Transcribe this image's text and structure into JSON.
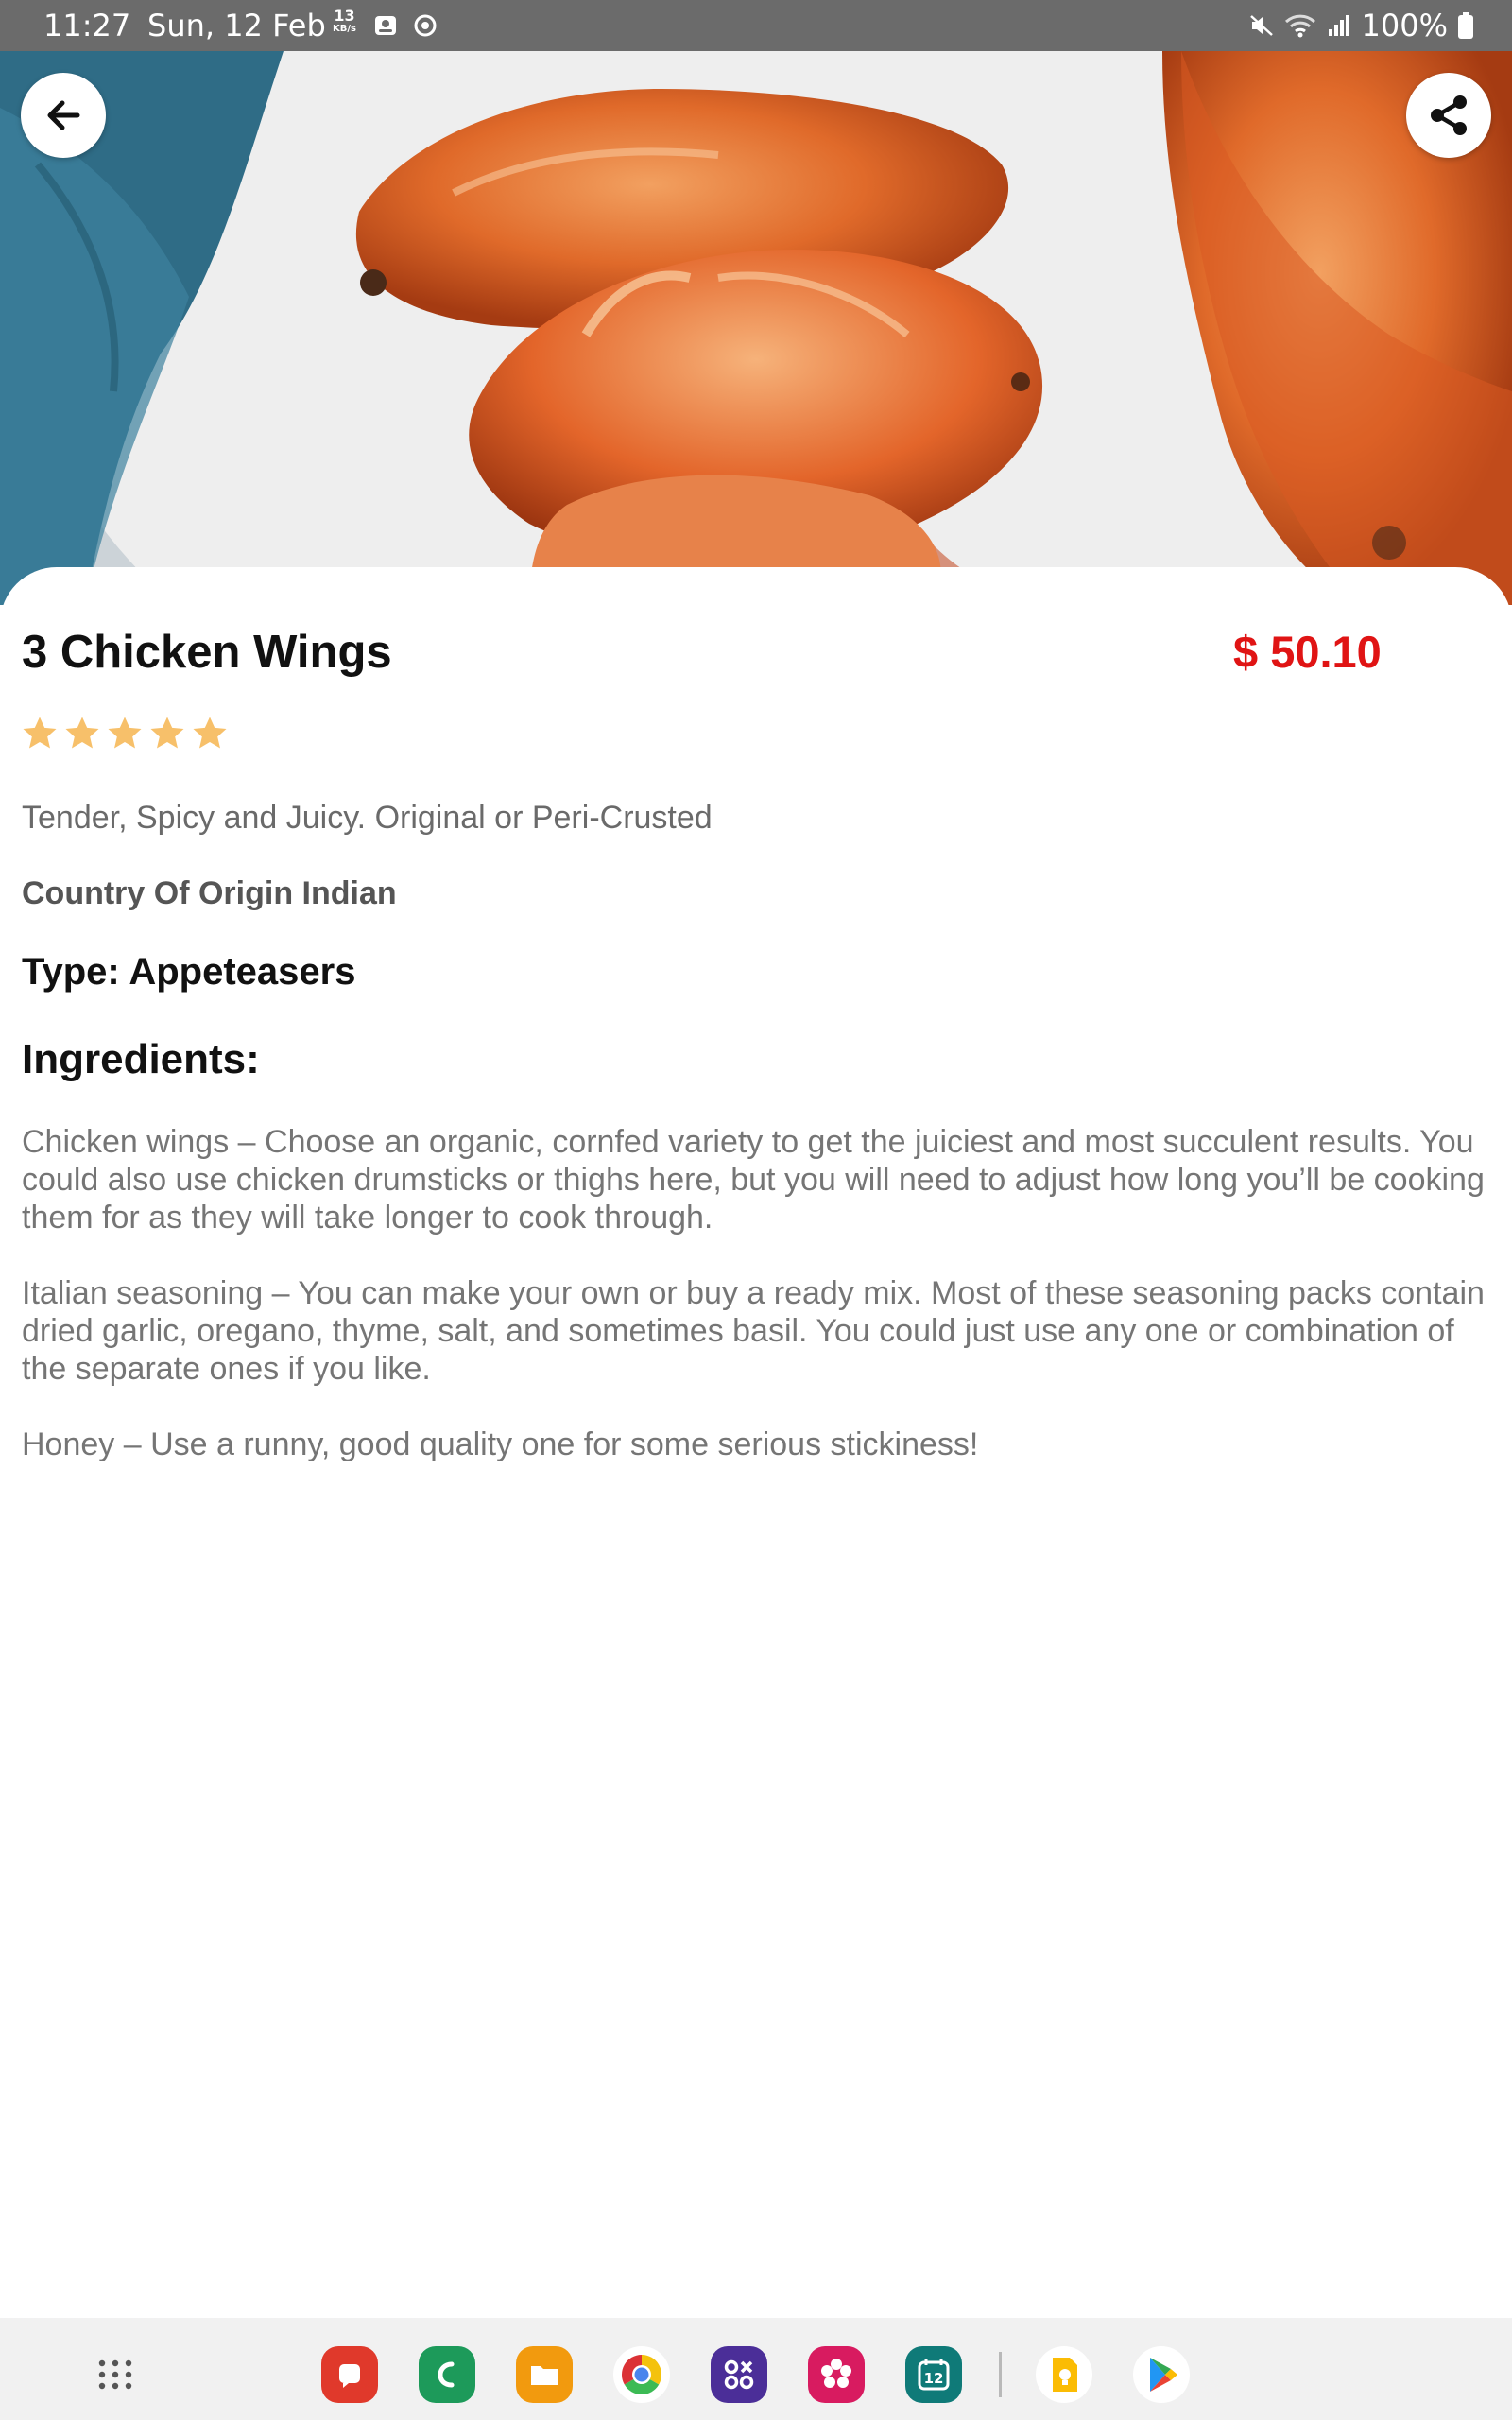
{
  "status_bar": {
    "time": "11:27",
    "date": "Sun, 12 Feb",
    "speed_value": "13",
    "speed_unit": "KB/s",
    "battery": "100%"
  },
  "hero": {
    "image": "chicken-wings-photo"
  },
  "toolbar": {
    "back_icon": "arrow-left-icon",
    "share_icon": "share-icon"
  },
  "product": {
    "name": "3 Chicken Wings",
    "price": "$ 50.10",
    "rating": 5,
    "rating_max": 5,
    "star_color": "#f7c06a",
    "tagline": "Tender, Spicy and Juicy. Original or Peri-Crusted",
    "origin": "Country Of Origin Indian",
    "type": "Type: Appeteasers",
    "ingredients_heading": "Ingredients:",
    "ingredients": [
      "Chicken wings – Choose an organic, cornfed variety to get the juiciest and most succulent results. You could also use chicken drumsticks or thighs here, but you will need to adjust how long you’ll be cooking them for as they will take longer to cook through.",
      "Italian seasoning – You can make your own or buy a ready mix.  Most of these seasoning packs contain dried garlic, oregano, thyme, salt, and sometimes basil. You could just use any one or combination of the separate ones if you like.",
      "Honey – Use a runny, good quality one for some serious stickiness!"
    ]
  },
  "colors": {
    "price": "#e01414",
    "accent_text": "#111111",
    "status_bar": "#6b6b6b"
  },
  "taskbar": {
    "apps": [
      "apps-grid-icon",
      "notes-icon",
      "phone-icon",
      "files-icon",
      "chrome-icon",
      "game-launcher-icon",
      "gallery-icon",
      "calendar-icon",
      "keep-icon",
      "play-store-icon"
    ],
    "calendar_day": "12"
  }
}
